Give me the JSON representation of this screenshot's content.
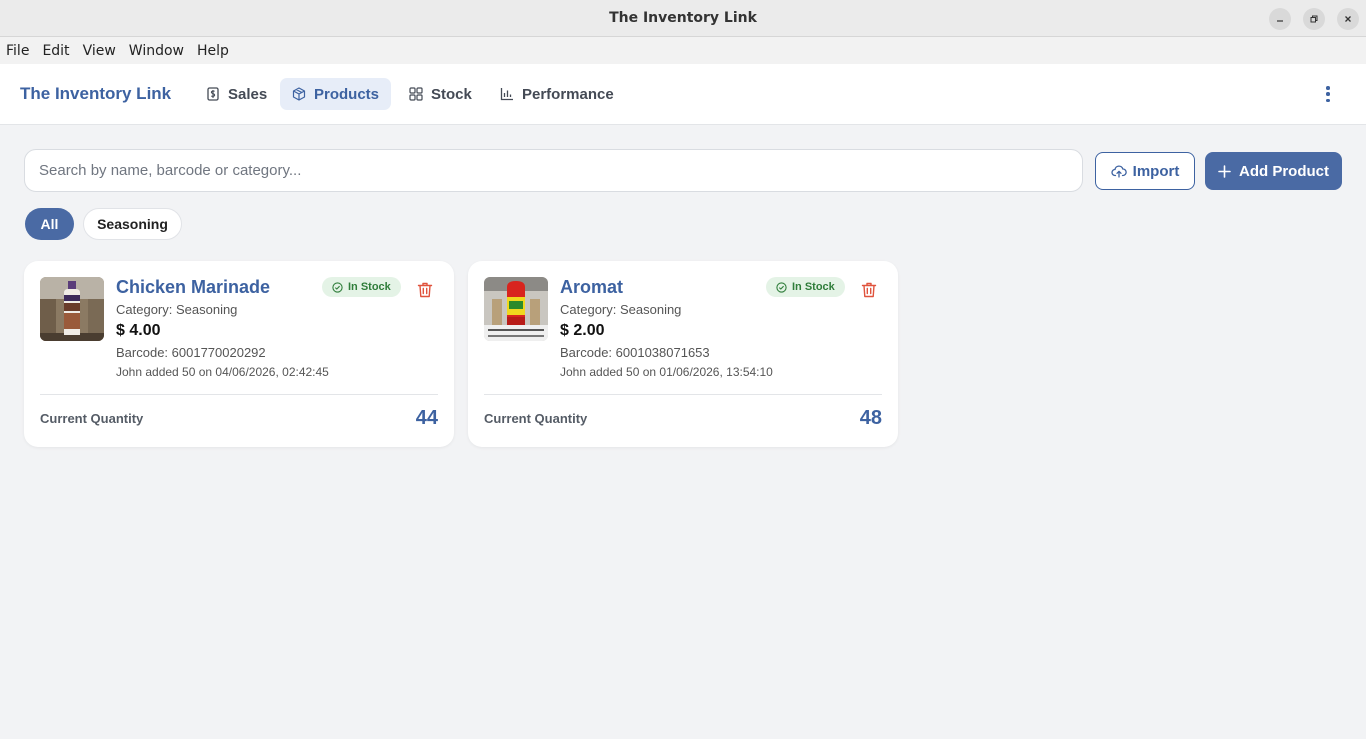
{
  "window": {
    "title": "The Inventory Link"
  },
  "menu": [
    "File",
    "Edit",
    "View",
    "Window",
    "Help"
  ],
  "header": {
    "brand": "The Inventory Link",
    "nav": [
      {
        "label": "Sales",
        "icon": "dollar-icon"
      },
      {
        "label": "Products",
        "icon": "box-icon",
        "active": true
      },
      {
        "label": "Stock",
        "icon": "grid-icon"
      },
      {
        "label": "Performance",
        "icon": "bar-chart-icon"
      }
    ]
  },
  "toolbar": {
    "search_placeholder": "Search by name, barcode or category...",
    "search_value": "",
    "import_label": "Import",
    "add_label": "Add Product"
  },
  "filters": [
    {
      "label": "All",
      "active": true
    },
    {
      "label": "Seasoning",
      "active": false
    }
  ],
  "products": [
    {
      "name": "Chicken Marinade",
      "category": "Category: Seasoning",
      "price": "$ 4.00",
      "barcode": "Barcode: 6001770020292",
      "added": "John added 50 on 04/06/2026, 02:42:45",
      "status": "In Stock",
      "quantity_label": "Current Quantity",
      "quantity": "44"
    },
    {
      "name": "Aromat",
      "category": "Category: Seasoning",
      "price": "$ 2.00",
      "barcode": "Barcode: 6001038071653",
      "added": "John added 50 on 01/06/2026, 13:54:10",
      "status": "In Stock",
      "quantity_label": "Current Quantity",
      "quantity": "48"
    }
  ],
  "colors": {
    "accent": "#3d62a1",
    "primary_button": "#4a6aa4",
    "in_stock_bg": "#e4f3e6",
    "in_stock_text": "#2f7d3a",
    "danger": "#e0533d"
  }
}
